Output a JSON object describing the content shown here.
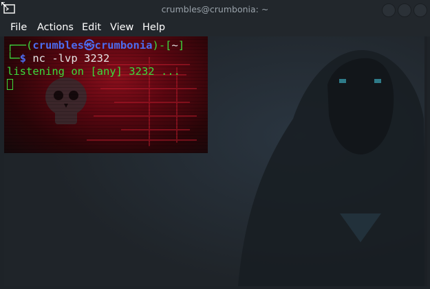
{
  "window": {
    "title": "crumbles@crumbonia: ~",
    "app_icon": "terminal-icon",
    "controls": [
      "minimize-icon",
      "maximize-icon",
      "close-icon"
    ]
  },
  "menu": {
    "items": [
      "File",
      "Actions",
      "Edit",
      "View",
      "Help"
    ]
  },
  "terminal": {
    "prompt_user": "crumbles",
    "prompt_symbol": "㉿",
    "prompt_host": "crumbonia",
    "prompt_dir": "~",
    "command": "nc -lvp 3232",
    "output": "listening on [any] 3232 ..."
  },
  "colors": {
    "prompt_green": "#3ddc3d",
    "prompt_blue": "#4c6cf0",
    "background": "#1e2328",
    "terminal_bg_red": "#8a0f1c"
  }
}
